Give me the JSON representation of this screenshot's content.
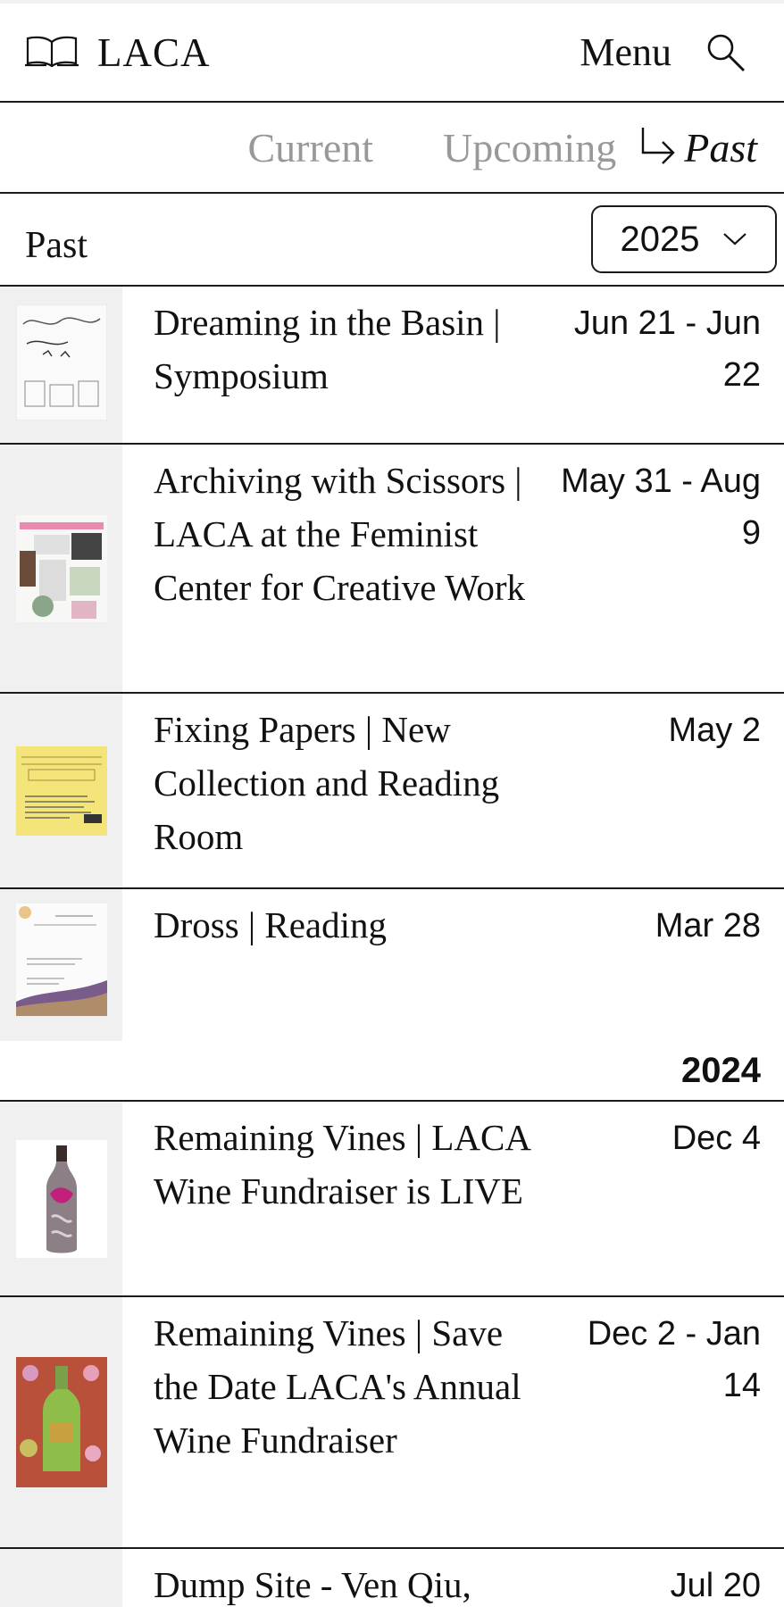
{
  "header": {
    "logo": "LACA",
    "menu_label": "Menu",
    "book_icon": "book-icon",
    "search_icon": "search-icon"
  },
  "tabs": [
    {
      "label": "Current",
      "active": false
    },
    {
      "label": "Upcoming",
      "active": false
    },
    {
      "label": "Past",
      "active": true
    }
  ],
  "filter": {
    "section_title": "Past",
    "selected_year": "2025"
  },
  "events": [
    {
      "title": "Dreaming in the Basin | Symposium",
      "date": "Jun 21 - Jun 22"
    },
    {
      "title": "Archiving with Scissors | LACA at the Feminist Center for Creative Work",
      "date": "May 31 - Aug 9"
    },
    {
      "title": "Fixing Papers | New Collection and Reading Room",
      "date": "May 2"
    },
    {
      "title": "Dross | Reading",
      "date": "Mar 28"
    }
  ],
  "year_divider": "2024",
  "events_2024": [
    {
      "title": "Remaining Vines | LACA Wine Fundraiser is LIVE",
      "date": "Dec 4"
    },
    {
      "title": "Remaining Vines | Save the Date LACA's Annual Wine Fundraiser",
      "date": "Dec 2 - Jan 14"
    },
    {
      "title": "Dump Site - Ven Qiu,",
      "date": "Jul 20"
    }
  ],
  "colors": {
    "border": "#1a1a1a",
    "inactive_tab": "#999999",
    "thumb_bg": "#f0f0f0"
  }
}
